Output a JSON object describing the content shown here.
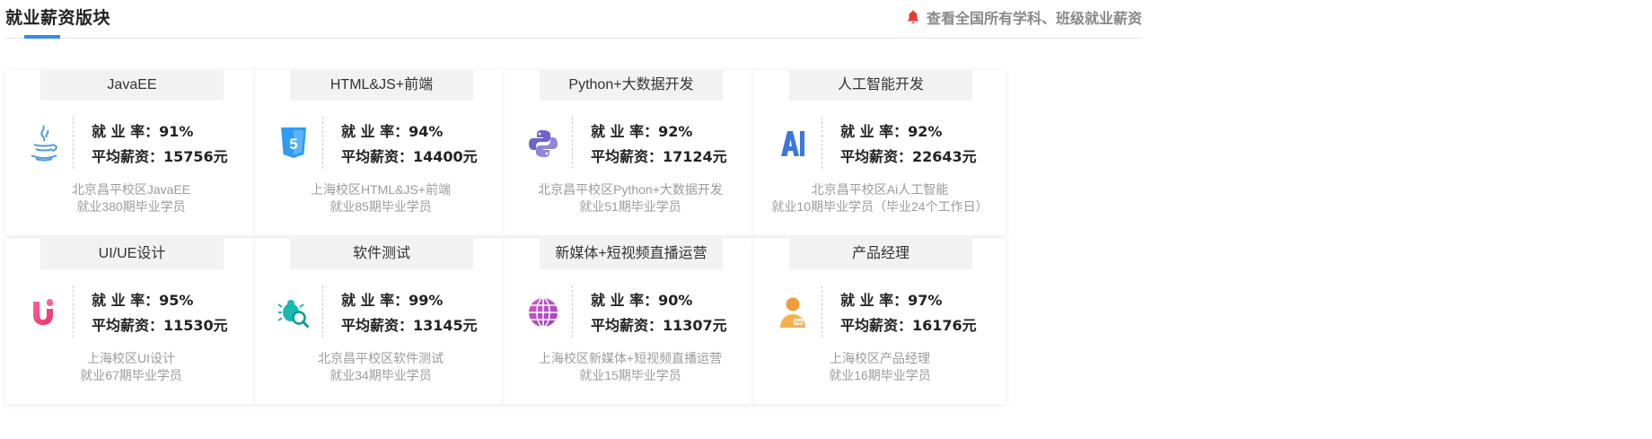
{
  "section": {
    "title": "就业薪资版块",
    "header_link": "查看全国所有学科、班级就业薪资",
    "accent_color": "#2f8af0",
    "bell_color": "#e53935"
  },
  "labels": {
    "rate": "就 业 率：",
    "salary": "平均薪资："
  },
  "cards": [
    {
      "name": "JavaEE",
      "icon": "java-icon",
      "rate": "91%",
      "salary": "15756元",
      "desc1": "北京昌平校区JavaEE",
      "desc2": "就业380期毕业学员"
    },
    {
      "name": "HTML&JS+前端",
      "icon": "html5-icon",
      "rate": "94%",
      "salary": "14400元",
      "desc1": "上海校区HTML&JS+前端",
      "desc2": "就业85期毕业学员"
    },
    {
      "name": "Python+大数据开发",
      "icon": "python-icon",
      "rate": "92%",
      "salary": "17124元",
      "desc1": "北京昌平校区Python+大数据开发",
      "desc2": "就业51期毕业学员"
    },
    {
      "name": "人工智能开发",
      "icon": "ai-icon",
      "rate": "92%",
      "salary": "22643元",
      "desc1": "北京昌平校区Ai人工智能",
      "desc2": "就业10期毕业学员（毕业24个工作日）"
    },
    {
      "name": "UI/UE设计",
      "icon": "ui-design-icon",
      "rate": "95%",
      "salary": "11530元",
      "desc1": "上海校区UI设计",
      "desc2": "就业67期毕业学员"
    },
    {
      "name": "软件测试",
      "icon": "bug-search-icon",
      "rate": "99%",
      "salary": "13145元",
      "desc1": "北京昌平校区软件测试",
      "desc2": "就业34期毕业学员"
    },
    {
      "name": "新媒体+短视频直播运营",
      "icon": "globe-icon",
      "rate": "90%",
      "salary": "11307元",
      "desc1": "上海校区新媒体+短视频直播运营",
      "desc2": "就业15期毕业学员"
    },
    {
      "name": "产品经理",
      "icon": "product-manager-icon",
      "rate": "97%",
      "salary": "16176元",
      "desc1": "上海校区产品经理",
      "desc2": "就业16期毕业学员"
    }
  ]
}
